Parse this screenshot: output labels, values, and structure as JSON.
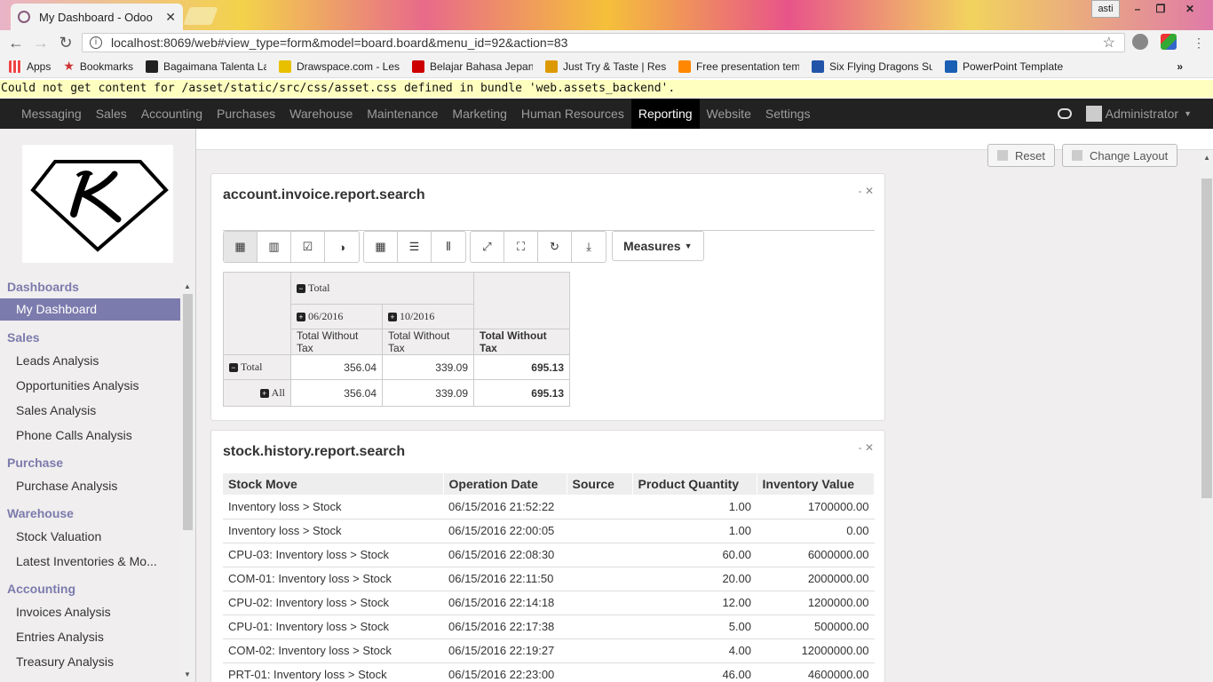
{
  "browser": {
    "tab_title": "My Dashboard - Odoo",
    "user_chip": "asti",
    "url": "localhost:8069/web#view_type=form&model=board.board&menu_id=92&action=83",
    "bookmarks": [
      {
        "label": "Apps",
        "color": "#e44"
      },
      {
        "label": "Bookmarks",
        "color": "#c33"
      },
      {
        "label": "Bagaimana Talenta La",
        "color": "#222"
      },
      {
        "label": "Drawspace.com - Less",
        "color": "#e8c000"
      },
      {
        "label": "Belajar Bahasa Jepang",
        "color": "#c00"
      },
      {
        "label": "Just Try & Taste | Resc",
        "color": "#d90"
      },
      {
        "label": "Free presentation tem",
        "color": "#f80"
      },
      {
        "label": "Six Flying Dragons Su",
        "color": "#2255aa"
      },
      {
        "label": "PowerPoint Template",
        "color": "#1a5fb4"
      }
    ],
    "more": "»"
  },
  "warning": "Could not get content for /asset/static/src/css/asset.css defined in bundle 'web.assets_backend'.",
  "topmenu": {
    "items": [
      "Messaging",
      "Sales",
      "Accounting",
      "Purchases",
      "Warehouse",
      "Maintenance",
      "Marketing",
      "Human Resources",
      "Reporting",
      "Website",
      "Settings"
    ],
    "active": "Reporting",
    "user": "Administrator"
  },
  "sidebar": {
    "sections": [
      {
        "title": "Dashboards",
        "items": [
          "My Dashboard"
        ]
      },
      {
        "title": "Sales",
        "items": [
          "Leads Analysis",
          "Opportunities Analysis",
          "Sales Analysis",
          "Phone Calls Analysis"
        ]
      },
      {
        "title": "Purchase",
        "items": [
          "Purchase Analysis"
        ]
      },
      {
        "title": "Warehouse",
        "items": [
          "Stock Valuation",
          "Latest Inventories & Mo..."
        ]
      },
      {
        "title": "Accounting",
        "items": [
          "Invoices Analysis",
          "Entries Analysis",
          "Treasury Analysis"
        ]
      }
    ],
    "active": "My Dashboard"
  },
  "controls": {
    "reset": "Reset",
    "change_layout": "Change Layout"
  },
  "panel1": {
    "title": "account.invoice.report.search",
    "measures_label": "Measures",
    "pivot": {
      "col_total": "Total",
      "col1": "06/2016",
      "col2": "10/2016",
      "measure": "Total Without Tax",
      "row_total": "Total",
      "row_all": "All",
      "values": {
        "total_row": [
          "356.04",
          "339.09",
          "695.13"
        ],
        "all_row": [
          "356.04",
          "339.09",
          "695.13"
        ]
      }
    }
  },
  "panel2": {
    "title": "stock.history.report.search",
    "columns": [
      "Stock Move",
      "Operation Date",
      "Source",
      "Product Quantity",
      "Inventory Value"
    ],
    "rows": [
      [
        "Inventory loss > Stock",
        "06/15/2016 21:52:22",
        "",
        "1.00",
        "1700000.00"
      ],
      [
        "Inventory loss > Stock",
        "06/15/2016 22:00:05",
        "",
        "1.00",
        "0.00"
      ],
      [
        "CPU-03: Inventory loss > Stock",
        "06/15/2016 22:08:30",
        "",
        "60.00",
        "6000000.00"
      ],
      [
        "COM-01: Inventory loss > Stock",
        "06/15/2016 22:11:50",
        "",
        "20.00",
        "2000000.00"
      ],
      [
        "CPU-02: Inventory loss > Stock",
        "06/15/2016 22:14:18",
        "",
        "12.00",
        "1200000.00"
      ],
      [
        "CPU-01: Inventory loss > Stock",
        "06/15/2016 22:17:38",
        "",
        "5.00",
        "500000.00"
      ],
      [
        "COM-02: Inventory loss > Stock",
        "06/15/2016 22:19:27",
        "",
        "4.00",
        "12000000.00"
      ],
      [
        "PRT-01: Inventory loss > Stock",
        "06/15/2016 22:23:00",
        "",
        "46.00",
        "4600000.00"
      ]
    ]
  },
  "colors": {
    "accent": "#7c7bad",
    "topbar": "#222222",
    "warning_bg": "#ffffc0"
  }
}
